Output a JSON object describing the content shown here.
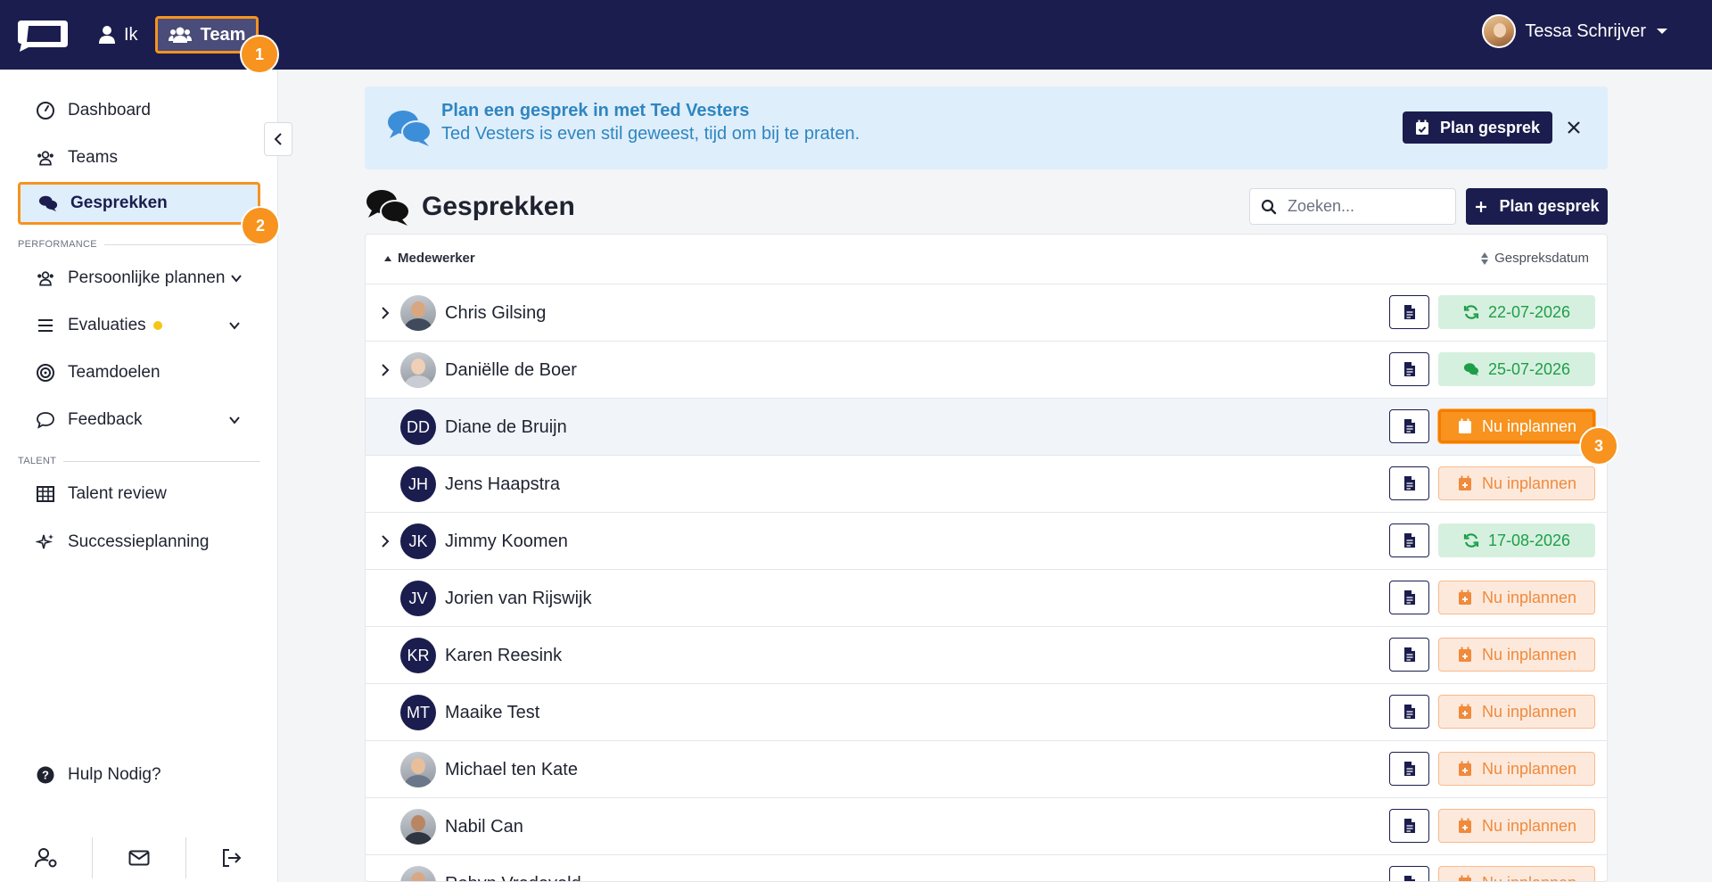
{
  "topbar": {
    "nav": [
      {
        "label": "Ik",
        "icon": "user-icon"
      },
      {
        "label": "Team",
        "icon": "users-icon"
      }
    ],
    "user": {
      "name": "Tessa Schrijver"
    }
  },
  "steps": [
    "1",
    "2",
    "3"
  ],
  "sidebar": {
    "items": [
      {
        "label": "Dashboard",
        "icon": "gauge-icon"
      },
      {
        "label": "Teams",
        "icon": "users-icon"
      },
      {
        "label": "Gesprekken",
        "icon": "comments-icon"
      },
      {
        "label": "Persoonlijke plannen",
        "icon": "users-icon"
      },
      {
        "label": "Evaluaties",
        "icon": "list-icon"
      },
      {
        "label": "Teamdoelen",
        "icon": "target-icon"
      },
      {
        "label": "Feedback",
        "icon": "comment-icon"
      },
      {
        "label": "Talent review",
        "icon": "grid-icon"
      },
      {
        "label": "Successieplanning",
        "icon": "sparkle-icon"
      }
    ],
    "sections": {
      "performance": "PERFORMANCE",
      "talent": "TALENT"
    },
    "help": "Hulp Nodig?"
  },
  "banner": {
    "title": "Plan een gesprek in met Ted Vesters",
    "subtitle": "Ted Vesters is even stil geweest, tijd om bij te praten.",
    "button": "Plan gesprek"
  },
  "main": {
    "title": "Gesprekken",
    "search_placeholder": "Zoeken...",
    "plan_button": "Plan gesprek",
    "columns": {
      "employee": "Medewerker",
      "date": "Gespreksdatum"
    }
  },
  "rows": [
    {
      "name": "Chris Gilsing",
      "initials": "",
      "expandable": true,
      "status": "green",
      "status_icon": "sync-icon",
      "status_label": "22-07-2026"
    },
    {
      "name": "Daniëlle de Boer",
      "initials": "",
      "expandable": true,
      "status": "green",
      "status_icon": "comments-icon",
      "status_label": "25-07-2026"
    },
    {
      "name": "Diane de Bruijn",
      "initials": "DD",
      "expandable": false,
      "status": "orange-solid",
      "status_icon": "calendar-plus-icon",
      "status_label": "Nu inplannen"
    },
    {
      "name": "Jens Haapstra",
      "initials": "JH",
      "expandable": false,
      "status": "orange-light",
      "status_icon": "calendar-plus-icon",
      "status_label": "Nu inplannen"
    },
    {
      "name": "Jimmy Koomen",
      "initials": "JK",
      "expandable": true,
      "status": "green",
      "status_icon": "sync-icon",
      "status_label": "17-08-2026"
    },
    {
      "name": "Jorien van Rijswijk",
      "initials": "JV",
      "expandable": false,
      "status": "orange-light",
      "status_icon": "calendar-plus-icon",
      "status_label": "Nu inplannen"
    },
    {
      "name": "Karen Reesink",
      "initials": "KR",
      "expandable": false,
      "status": "orange-light",
      "status_icon": "calendar-plus-icon",
      "status_label": "Nu inplannen"
    },
    {
      "name": "Maaike Test",
      "initials": "MT",
      "expandable": false,
      "status": "orange-light",
      "status_icon": "calendar-plus-icon",
      "status_label": "Nu inplannen"
    },
    {
      "name": "Michael ten Kate",
      "initials": "",
      "expandable": false,
      "status": "orange-light",
      "status_icon": "calendar-plus-icon",
      "status_label": "Nu inplannen"
    },
    {
      "name": "Nabil Can",
      "initials": "",
      "expandable": false,
      "status": "orange-light",
      "status_icon": "calendar-plus-icon",
      "status_label": "Nu inplannen"
    },
    {
      "name": "Robyn Vredeveld",
      "initials": "",
      "expandable": false,
      "status": "orange-light",
      "status_icon": "calendar-plus-icon",
      "status_label": "Nu inplannen"
    }
  ],
  "colors": {
    "navy": "#1b1d4e",
    "accent_orange": "#f7931e",
    "success_green": "#1e9e49",
    "info_blue": "#2e86c1"
  }
}
